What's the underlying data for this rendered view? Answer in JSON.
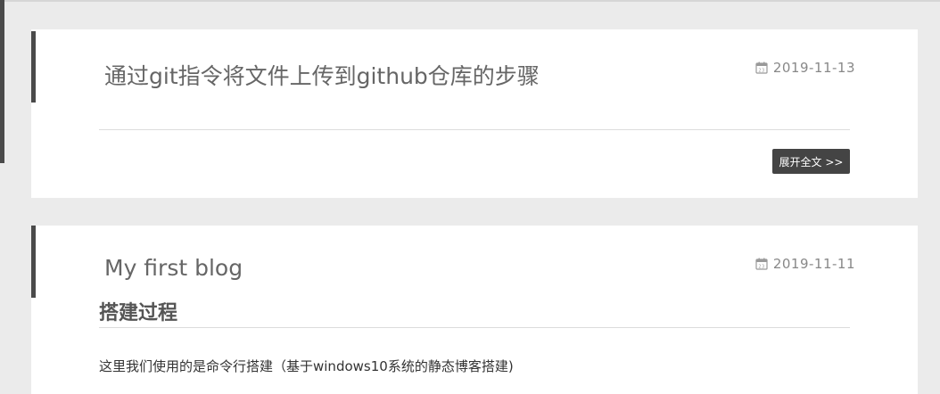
{
  "posts": [
    {
      "title": "通过git指令将文件上传到github仓库的步骤",
      "date": "2019-11-13",
      "read_more_label": "展开全文 >>"
    },
    {
      "title": "My first blog",
      "date": "2019-11-11",
      "section_heading": "搭建过程",
      "body": "这里我们使用的是命令行搭建（基于windows10系统的静态博客搭建)"
    }
  ],
  "icons": {
    "date": "calendar-icon"
  },
  "colors": {
    "accent": "#4a4a4a",
    "button_bg": "#444444",
    "page_bg": "#ebebeb"
  }
}
